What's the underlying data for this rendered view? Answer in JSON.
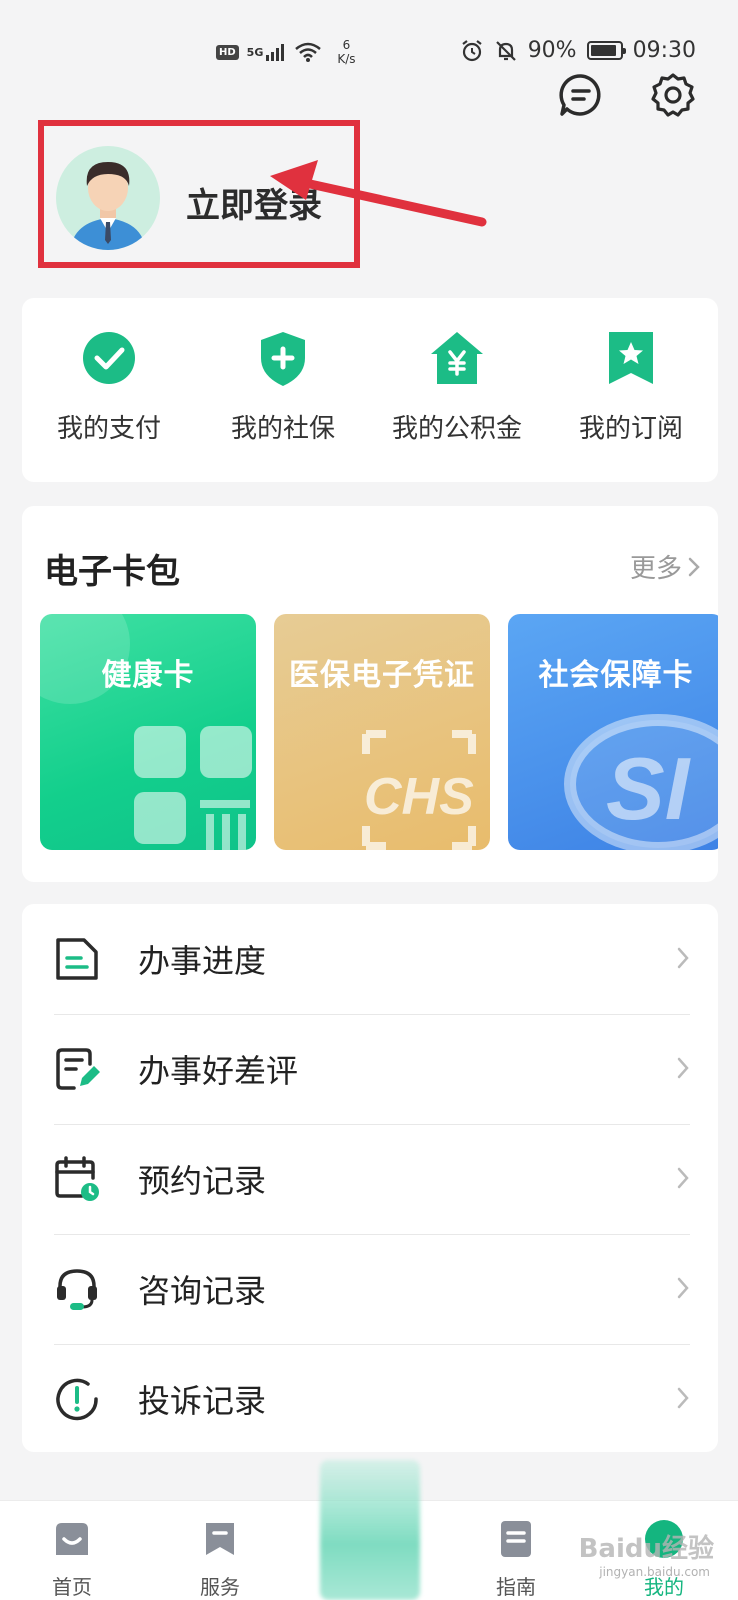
{
  "status_bar": {
    "hd": "HD",
    "network": "5G",
    "speed_value": "6",
    "speed_unit": "K/s",
    "battery": "90%",
    "time": "09:30"
  },
  "header": {
    "message_icon": "message-icon",
    "settings_icon": "gear-icon"
  },
  "profile": {
    "login_label": "立即登录"
  },
  "quick_links": [
    {
      "label": "我的支付",
      "icon": "check-circle-icon"
    },
    {
      "label": "我的社保",
      "icon": "shield-plus-icon"
    },
    {
      "label": "我的公积金",
      "icon": "house-yen-icon"
    },
    {
      "label": "我的订阅",
      "icon": "bookmark-star-icon"
    }
  ],
  "wallet": {
    "title": "电子卡包",
    "more_label": "更多",
    "cards": [
      {
        "label": "健康卡",
        "color": "#13cf8c"
      },
      {
        "label": "医保电子凭证",
        "color": "#e8bc6c"
      },
      {
        "label": "社会保障卡",
        "color": "#3d82e5"
      }
    ]
  },
  "service_list": [
    {
      "label": "办事进度",
      "icon": "document-icon"
    },
    {
      "label": "办事好差评",
      "icon": "review-edit-icon"
    },
    {
      "label": "预约记录",
      "icon": "calendar-clock-icon"
    },
    {
      "label": "咨询记录",
      "icon": "headset-icon"
    },
    {
      "label": "投诉记录",
      "icon": "exclamation-circle-icon"
    }
  ],
  "bottom_nav": [
    {
      "label": "首页",
      "icon": "home-icon"
    },
    {
      "label": "服务",
      "icon": "bookmark-icon"
    },
    {
      "label": "指南",
      "icon": "guide-icon"
    },
    {
      "label": "我的",
      "icon": "profile-icon",
      "active": true
    }
  ],
  "watermark": {
    "text": "Baidu经验",
    "sub": "jingyan.baidu.com"
  },
  "colors": {
    "accent": "#1cb27e",
    "highlight_box": "#e0313e"
  }
}
